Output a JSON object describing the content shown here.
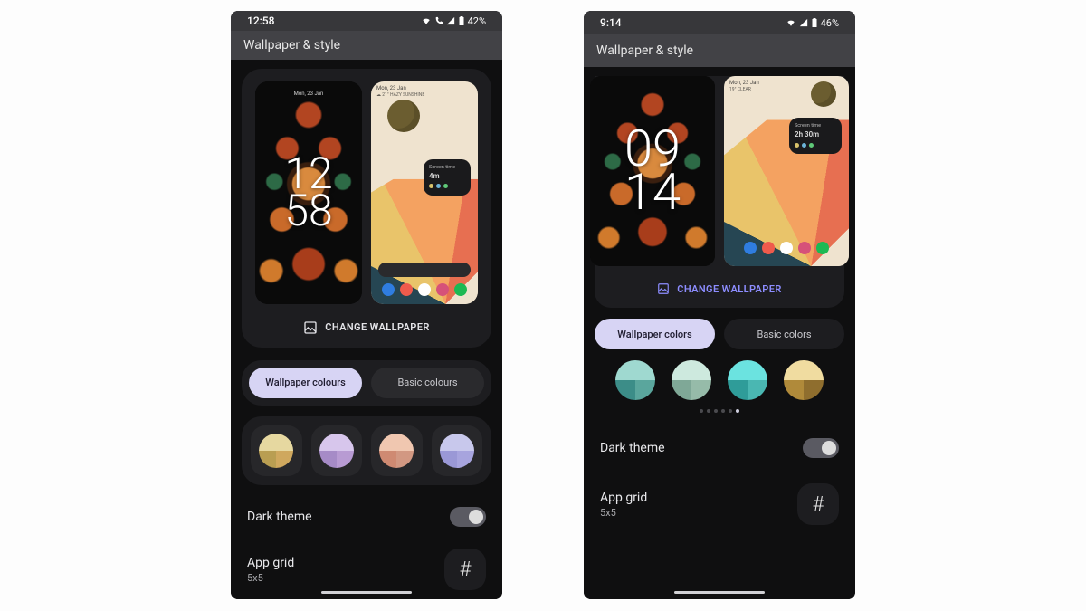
{
  "left": {
    "status": {
      "time": "12:58",
      "battery": "42%"
    },
    "title": "Wallpaper & style",
    "lock": {
      "date": "Mon, 23 Jan",
      "h": "12",
      "m": "58"
    },
    "home": {
      "status_line1": "Mon, 23 Jan",
      "status_line2": "☁ 21° HAZY SUNSHINE",
      "screen_time_label": "Screen time",
      "screen_time_value": "4m"
    },
    "change_label": "CHANGE WALLPAPER",
    "tabs": {
      "active": "Wallpaper colours",
      "inactive": "Basic colours"
    },
    "swatches": [
      {
        "tl": "#e6d8a0",
        "tr": "#e6d8a0",
        "bl": "#b99e52",
        "br": "#cfa85e"
      },
      {
        "tl": "#d7c6ec",
        "tr": "#d7c6ec",
        "bl": "#a68bc7",
        "br": "#b89bd3"
      },
      {
        "tl": "#f0c7b0",
        "tr": "#f0c7b0",
        "bl": "#cf8a72",
        "br": "#d29882"
      },
      {
        "tl": "#c8c8ec",
        "tr": "#c8c8ec",
        "bl": "#9a98d6",
        "br": "#a7a4de"
      }
    ],
    "dark_theme": "Dark theme",
    "app_grid": {
      "label": "App grid",
      "value": "5x5",
      "glyph": "#"
    }
  },
  "right": {
    "status": {
      "time": "9:14",
      "battery": "46%"
    },
    "title": "Wallpaper & style",
    "lock": {
      "h": "09",
      "m": "14"
    },
    "home": {
      "status_line1": "Mon, 23 Jan",
      "status_line2": "19° CLEAR",
      "screen_time_label": "Screen time",
      "screen_time_value": "2h 30m"
    },
    "change_label": "CHANGE WALLPAPER",
    "tabs": {
      "active": "Wallpaper colors",
      "inactive": "Basic colors"
    },
    "swatches": [
      {
        "tl": "#9fd9d0",
        "tr": "#9fd9d0",
        "bl": "#3c8d88",
        "br": "#5aa69d"
      },
      {
        "tl": "#cde9de",
        "tr": "#cde9de",
        "bl": "#7fa897",
        "br": "#96bba9"
      },
      {
        "tl": "#6be3e0",
        "tr": "#6be3e0",
        "bl": "#2f9c99",
        "br": "#4ab7b2"
      },
      {
        "tl": "#f0dca0",
        "tr": "#f0dca0",
        "bl": "#b08a3a",
        "br": "#8f6e2e"
      }
    ],
    "page_dots": 6,
    "page_active": 5,
    "dark_theme": "Dark theme",
    "app_grid": {
      "label": "App grid",
      "value": "5x5",
      "glyph": "#"
    }
  },
  "dock_colors": [
    "#2f7de0",
    "#ef5b4c",
    "#2aa0d8",
    "#d65179",
    "#1db954"
  ]
}
